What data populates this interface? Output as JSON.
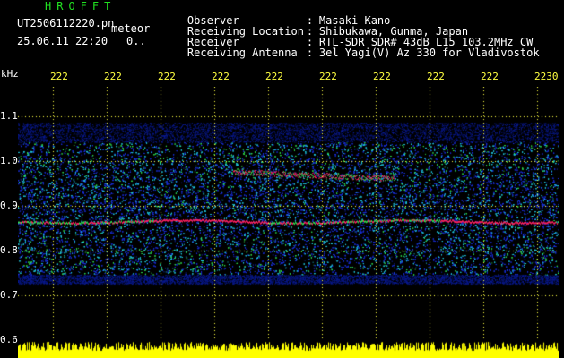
{
  "header": {
    "app_title": "HROFFT",
    "file_name": "UT2506112220.pn",
    "mode_label": "meteor",
    "date_time": "25.06.11 22:20",
    "status": "0.."
  },
  "metadata": [
    {
      "key": "Observer",
      "value": "Masaki Kano"
    },
    {
      "key": "Receiving Location",
      "value": "Shibukawa, Gunma, Japan"
    },
    {
      "key": "Receiver",
      "value": "RTL-SDR SDR# 43dB L15 103.2MHz CW"
    },
    {
      "key": "Receiving Antenna",
      "value": "3el Yagi(V) Az 330 for Vladivostok"
    }
  ],
  "axis": {
    "unit": "kHz",
    "time_ticks": [
      "222",
      "222",
      "222",
      "222",
      "222",
      "222",
      "222",
      "222",
      "222",
      "2230"
    ],
    "freq_ticks": [
      "1.1",
      "1.0",
      "0.9",
      "0.8",
      "0.7",
      "0.6"
    ]
  },
  "colors": {
    "title": "#21e021",
    "tick": "#ffff40",
    "grid": "#ffff40",
    "baseline": "#ffff00",
    "background": "#000000",
    "noise_low": "#1a2fd8",
    "noise_mid": "#20c8e0",
    "noise_high": "#30e050",
    "signal": "#ff2060"
  }
}
